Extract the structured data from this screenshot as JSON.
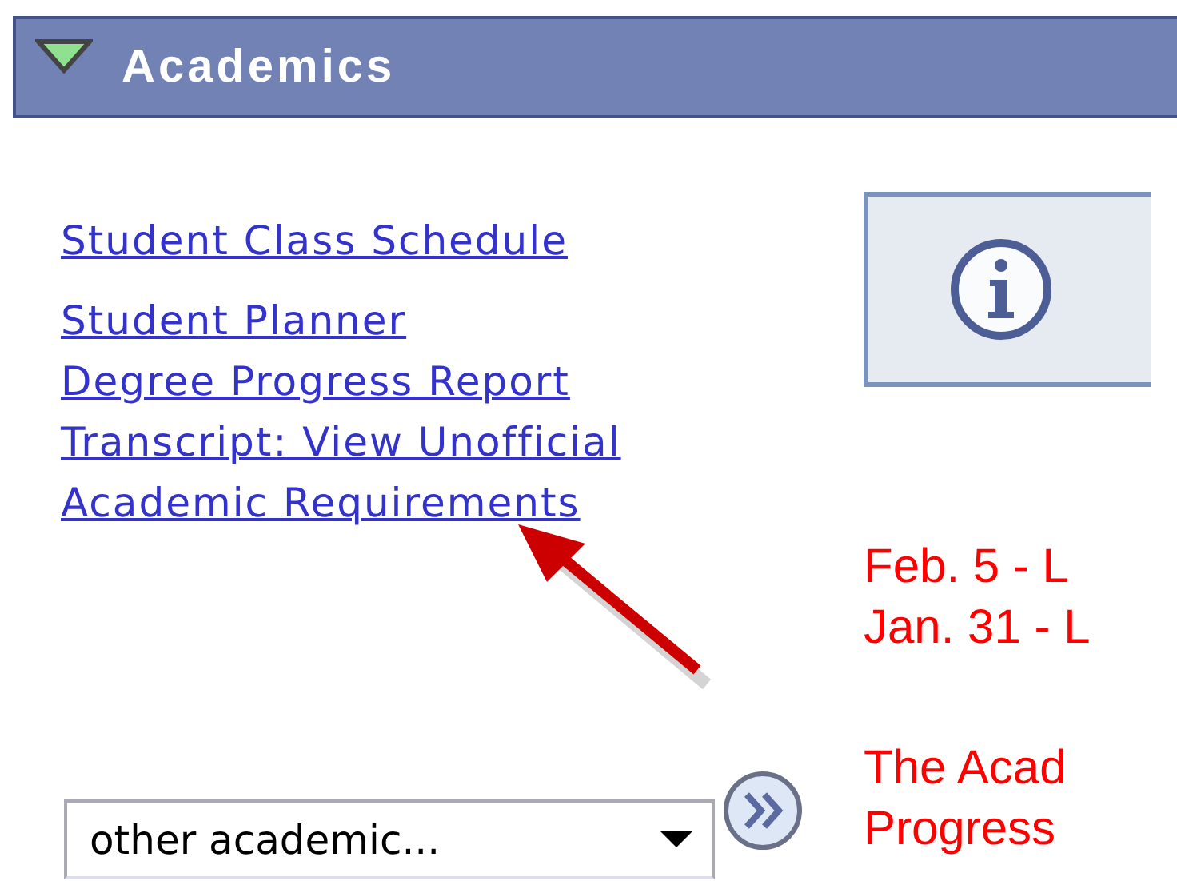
{
  "section": {
    "title": "Academics",
    "expanded": true
  },
  "links": [
    {
      "label": "Student Class Schedule"
    },
    {
      "label": "Student Planner"
    },
    {
      "label": "Degree Progress Report"
    },
    {
      "label": "Transcript: View Unofficial"
    },
    {
      "label": "Academic Requirements"
    }
  ],
  "dropdown": {
    "value": "other academic..."
  },
  "notices": [
    [
      "Feb. 5 - L",
      "Jan. 31 - L"
    ],
    [
      "The Acad",
      "Progress"
    ]
  ]
}
